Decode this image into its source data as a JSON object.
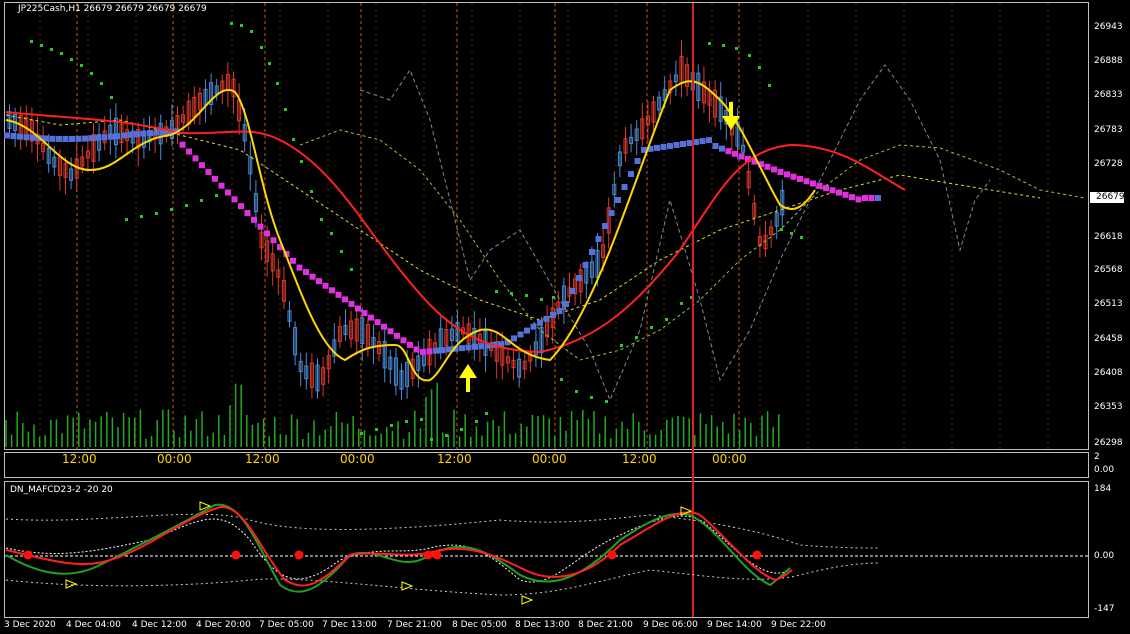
{
  "chart_title": "JP225Cash,H1  26679 26679 26679 26679",
  "price_axis": [
    "26943",
    "26888",
    "26833",
    "26783",
    "26728",
    "26673",
    "26618",
    "26568",
    "26513",
    "26458",
    "26408",
    "26353",
    "26298"
  ],
  "current_price": "26679",
  "session_labels": [
    {
      "text": "12:00",
      "color": "#ffd700"
    },
    {
      "text": "00:00",
      "color": "#ffd700"
    },
    {
      "text": "12:00",
      "color": "#ffd700"
    },
    {
      "text": "00:00",
      "color": "#ffd700"
    },
    {
      "text": "12:00",
      "color": "#ffd700"
    },
    {
      "text": "00:00",
      "color": "#ffd700"
    },
    {
      "text": "12:00",
      "color": "#ffd700"
    },
    {
      "text": "00:00",
      "color": "#ffd700"
    }
  ],
  "volume_axis": [
    "2",
    "0.00"
  ],
  "indicator": {
    "title": "DN_MAFCD23-2 -20 20",
    "axis": [
      "184",
      "0.00",
      "-147"
    ]
  },
  "date_labels": [
    "3 Dec 2020",
    "4 Dec 04:00",
    "4 Dec 12:00",
    "4 Dec 20:00",
    "7 Dec 05:00",
    "7 Dec 13:00",
    "7 Dec 21:00",
    "8 Dec 05:00",
    "8 Dec 13:00",
    "8 Dec 21:00",
    "9 Dec 06:00",
    "9 Dec 14:00",
    "9 Dec 22:00"
  ],
  "colors": {
    "bull_candle": "#4a8cd8",
    "bear_candle": "#e0392a",
    "fast_ma": "#ffd700",
    "slow_ma": "#ff2020",
    "trend_up": "#5570d8",
    "trend_down": "#e030e0",
    "psar": "#22cc22",
    "volume": "#22aa22",
    "signal_arrow": "#ffff00"
  }
}
